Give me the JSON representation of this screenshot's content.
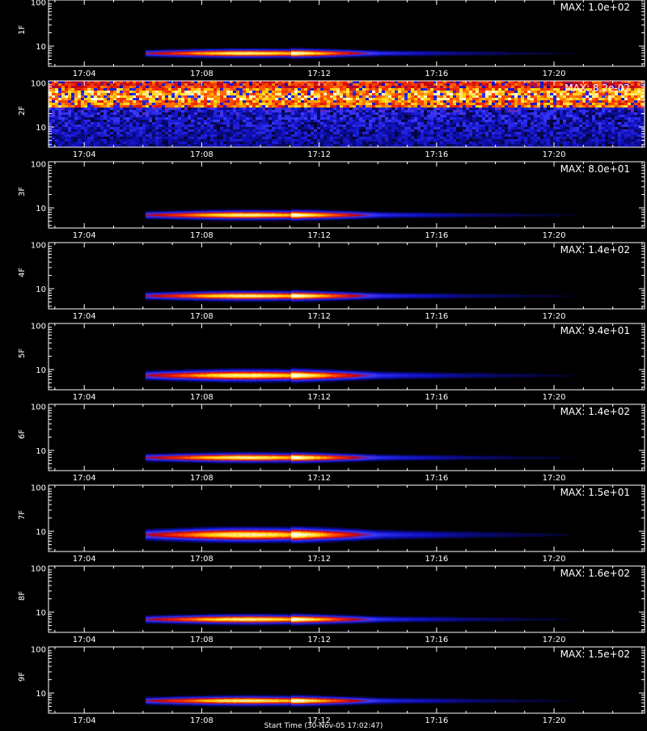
{
  "colors": {
    "background": "#000000",
    "axes": "#ffffff",
    "text": "#ffffff"
  },
  "chart_data": [
    {
      "type": "heatmap",
      "ylabel": "1F",
      "max_label": "MAX: 1.0e+02",
      "yticks": [
        "100",
        "10"
      ],
      "xticks": [
        "17:04",
        "17:08",
        "17:12",
        "17:16",
        "17:20"
      ],
      "emission": {
        "kind": "burst",
        "t_start": "17:06",
        "t_peak_start": "17:08",
        "t_peak_end": "17:11",
        "t_decay": "17:14",
        "peak_level": 7,
        "width": 2.2
      },
      "colormap": [
        "#000000",
        "#1010c0",
        "#3a3aff",
        "#c00010",
        "#ff4000",
        "#ffd000",
        "#ffffe0"
      ]
    },
    {
      "type": "heatmap",
      "ylabel": "2F",
      "max_label": "MAX: 8.2e-02",
      "yticks": [
        "100",
        "10"
      ],
      "xticks": [
        "17:04",
        "17:08",
        "17:12",
        "17:16",
        "17:20"
      ],
      "emission": {
        "kind": "noise",
        "band_low": 30,
        "band_high": 100
      },
      "colormap": [
        "#000000",
        "#1010c0",
        "#3a3aff",
        "#c00010",
        "#ff4000",
        "#ffd000",
        "#ffffe0"
      ]
    },
    {
      "type": "heatmap",
      "ylabel": "3F",
      "max_label": "MAX: 8.0e+01",
      "yticks": [
        "100",
        "10"
      ],
      "xticks": [
        "17:04",
        "17:08",
        "17:12",
        "17:16",
        "17:20"
      ],
      "emission": {
        "kind": "burst",
        "t_start": "17:06",
        "t_peak_start": "17:08",
        "t_peak_end": "17:11",
        "t_decay": "17:14",
        "peak_level": 7,
        "width": 2.4
      },
      "colormap": [
        "#000000",
        "#1010c0",
        "#3a3aff",
        "#c00010",
        "#ff4000",
        "#ffd000",
        "#ffffe0"
      ]
    },
    {
      "type": "heatmap",
      "ylabel": "4F",
      "max_label": "MAX: 1.4e+02",
      "yticks": [
        "100",
        "10"
      ],
      "xticks": [
        "17:04",
        "17:08",
        "17:12",
        "17:16",
        "17:20"
      ],
      "emission": {
        "kind": "burst",
        "t_start": "17:06",
        "t_peak_start": "17:08",
        "t_peak_end": "17:11",
        "t_decay": "17:14",
        "peak_level": 7,
        "width": 2.4
      },
      "colormap": [
        "#000000",
        "#1010c0",
        "#3a3aff",
        "#c00010",
        "#ff4000",
        "#ffd000",
        "#ffffe0"
      ]
    },
    {
      "type": "heatmap",
      "ylabel": "5F",
      "max_label": "MAX: 9.4e+01",
      "yticks": [
        "100",
        "10"
      ],
      "xticks": [
        "17:04",
        "17:08",
        "17:12",
        "17:16",
        "17:20"
      ],
      "emission": {
        "kind": "burst",
        "t_start": "17:06",
        "t_peak_start": "17:08",
        "t_peak_end": "17:11",
        "t_decay": "17:14",
        "peak_level": 7.5,
        "width": 3.0
      },
      "colormap": [
        "#000000",
        "#1010c0",
        "#3a3aff",
        "#c00010",
        "#ff4000",
        "#ffd000",
        "#ffffe0"
      ]
    },
    {
      "type": "heatmap",
      "ylabel": "6F",
      "max_label": "MAX: 1.4e+02",
      "yticks": [
        "100",
        "10"
      ],
      "xticks": [
        "17:04",
        "17:08",
        "17:12",
        "17:16",
        "17:20"
      ],
      "emission": {
        "kind": "burst",
        "t_start": "17:06",
        "t_peak_start": "17:08",
        "t_peak_end": "17:11",
        "t_decay": "17:14",
        "peak_level": 7,
        "width": 2.4
      },
      "colormap": [
        "#000000",
        "#1010c0",
        "#3a3aff",
        "#c00010",
        "#ff4000",
        "#ffd000",
        "#ffffe0"
      ]
    },
    {
      "type": "heatmap",
      "ylabel": "7F",
      "max_label": "MAX: 1.5e+01",
      "yticks": [
        "100",
        "10"
      ],
      "xticks": [
        "17:04",
        "17:08",
        "17:12",
        "17:16",
        "17:20"
      ],
      "emission": {
        "kind": "burst",
        "t_start": "17:06",
        "t_peak_start": "17:08",
        "t_peak_end": "17:11",
        "t_decay": "17:14",
        "peak_level": 8.5,
        "width": 3.6
      },
      "colormap": [
        "#000000",
        "#1010c0",
        "#3a3aff",
        "#c00010",
        "#ff4000",
        "#ffd000",
        "#ffffe0"
      ]
    },
    {
      "type": "heatmap",
      "ylabel": "8F",
      "max_label": "MAX: 1.6e+02",
      "yticks": [
        "100",
        "10"
      ],
      "xticks": [
        "17:04",
        "17:08",
        "17:12",
        "17:16",
        "17:20"
      ],
      "emission": {
        "kind": "burst",
        "t_start": "17:06",
        "t_peak_start": "17:08",
        "t_peak_end": "17:11",
        "t_decay": "17:14",
        "peak_level": 7,
        "width": 2.4
      },
      "colormap": [
        "#000000",
        "#1010c0",
        "#3a3aff",
        "#c00010",
        "#ff4000",
        "#ffd000",
        "#ffffe0"
      ]
    },
    {
      "type": "heatmap",
      "ylabel": "9F",
      "max_label": "MAX: 1.5e+02",
      "yticks": [
        "100",
        "10"
      ],
      "xticks": [
        "17:04",
        "17:08",
        "17:12",
        "17:16",
        "17:20"
      ],
      "emission": {
        "kind": "burst",
        "t_start": "17:06",
        "t_peak_start": "17:08",
        "t_peak_end": "17:11",
        "t_decay": "17:14",
        "peak_level": 6.8,
        "width": 2.4
      },
      "colormap": [
        "#000000",
        "#1010c0",
        "#3a3aff",
        "#c00010",
        "#ff4000",
        "#ffd000",
        "#ffffe0"
      ]
    }
  ],
  "footer": {
    "xtitle": "Start Time (30-Nov-05 17:02:47)"
  }
}
